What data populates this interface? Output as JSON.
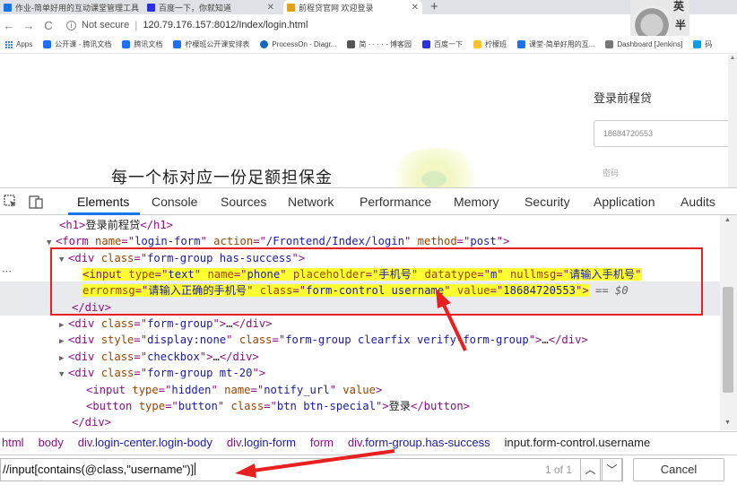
{
  "browser": {
    "tabs": [
      {
        "title": "作业-简单好用的互动课堂管理工具",
        "active": false,
        "color": "#1a73e8"
      },
      {
        "title": "百度一下，你就知道",
        "active": false,
        "color": "#2932e1"
      },
      {
        "title": "前程贷官网 欢迎登录",
        "active": true,
        "color": "#e0a020"
      }
    ],
    "new_tab": "+",
    "avatar": {
      "line1": "英",
      "line2": "半"
    },
    "nav": {
      "back": "←",
      "forward": "→",
      "reload": "C"
    },
    "security": "Not secure",
    "url": "120.79.176.157:8012/Index/login.html",
    "bookmarks": [
      {
        "label": "Apps",
        "color": "#4285f4"
      },
      {
        "label": "公开课 - 腾讯文档",
        "color": "#1e6fff"
      },
      {
        "label": "腾讯文档",
        "color": "#1e6fff"
      },
      {
        "label": "柠檬班公开课安排表",
        "color": "#1e6fff"
      },
      {
        "label": "ProcessOn - Diagr...",
        "color": "#1565c0"
      },
      {
        "label": "简 · · · · - 博客园",
        "color": "#555555"
      },
      {
        "label": "百度一下",
        "color": "#2932e1"
      },
      {
        "label": "柠檬班",
        "color": "#f4c430"
      },
      {
        "label": "课堂-简单好用的互...",
        "color": "#1a73e8"
      },
      {
        "label": "Dashboard [Jenkins]",
        "color": "#777777"
      },
      {
        "label": "码",
        "color": "#00a0e9"
      }
    ]
  },
  "page": {
    "hero_text": "每一个标对应一份足额担保金",
    "login_title": "登录前程贷",
    "phone_value": "18684720553",
    "password_placeholder": "密码"
  },
  "devtools": {
    "tabs": [
      "Elements",
      "Console",
      "Sources",
      "Network",
      "Performance",
      "Memory",
      "Security",
      "Application",
      "Audits"
    ],
    "active_tab": "Elements",
    "dom": {
      "h1_text": "登录前程贷",
      "form_name": "login-form",
      "form_action": "/Frontend/Index/login",
      "form_method": "post",
      "div1_class": "form-group has-success",
      "input_type": "text",
      "input_name": "phone",
      "input_placeholder": "手机号",
      "input_datatype": "m",
      "input_nullmsg": "请输入手机号",
      "input_errormsg": "请输入正确的手机号",
      "input_class": "form-control username",
      "input_value": "18684720553",
      "eq_marker": "== $0",
      "div2_class": "form-group",
      "div3_style": "display:none",
      "div3_class": "form-group clearfix verify-form-group",
      "div4_class": "checkbox",
      "div5_class": "form-group mt-20",
      "hidden_type": "hidden",
      "hidden_name": "notify_url",
      "hidden_attr": "value",
      "button_type": "button",
      "button_class": "btn btn-special",
      "button_text": "登录",
      "ellipsis": "…"
    },
    "breadcrumbs": [
      {
        "tag": "html",
        "cls": ""
      },
      {
        "tag": "body",
        "cls": ""
      },
      {
        "tag": "div",
        "cls": ".login-center.login-body"
      },
      {
        "tag": "div",
        "cls": ".login-form"
      },
      {
        "tag": "form",
        "cls": ""
      },
      {
        "tag": "div",
        "cls": ".form-group.has-success"
      },
      {
        "tag": "input",
        "cls": ".form-control.username"
      }
    ],
    "search": {
      "value": "//input[contains(@class,\"username\")]",
      "matches": "1 of 1",
      "cancel_label": "Cancel"
    }
  },
  "colors": {
    "annotation_red": "#e8201f",
    "highlight_yellow": "#ffff32",
    "tab_accent": "#1a73e8"
  }
}
